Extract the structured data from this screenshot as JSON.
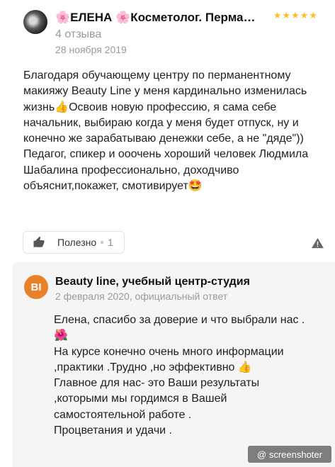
{
  "review": {
    "author": "🌸ЕЛЕНА 🌸Косметолог. Перманентный макияж",
    "reviews_count": "4 отзыва",
    "date": "28 ноября 2019",
    "rating": "★★★★★",
    "text": "Благодаря обучающему центру по перманентному макияжу Beauty Line у меня кардинально изменилась жизнь👍Освоив новую профессию, я сама себе начальник, выбираю когда у меня будет отпуск, ну и конечно же зарабатываю денежки себе, а не \"дяде\")) Педагог, спикер и ооочень хороший человек Людмила Шабалина профессионально, доходчиво объяснит,покажет, смотивирует🤩",
    "useful_label": "Полезно",
    "useful_count": "1"
  },
  "reply": {
    "logo_initials": "BI",
    "org_name": "Beauty line, учебный центр-студия",
    "meta": "2 февраля 2020, официальный ответ",
    "lines": [
      "Елена, спасибо за доверие и что выбрали нас .🌺",
      "На курсе конечно очень много информации ,практики .Трудно ,но эффективно 👍",
      "Главное для нас- это Ваши результаты ,которыми мы гордимся в Вашей самостоятельной работе .",
      "Процветания и удачи ."
    ]
  },
  "watermark": "@ screenshoter",
  "colors": {
    "stars": "#fdbe2c",
    "logo": "#e8812a",
    "reply_bg": "#f5f5f5",
    "meta": "#9a9a9a"
  }
}
